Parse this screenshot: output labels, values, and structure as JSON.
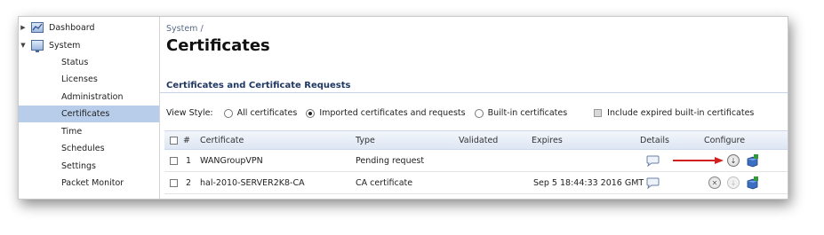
{
  "sidebar": {
    "groups": [
      {
        "label": "Dashboard",
        "icon": "dashboard-chart-icon",
        "arrow": "collapsed"
      },
      {
        "label": "System",
        "icon": "monitor-icon",
        "arrow": "expanded"
      }
    ],
    "items": [
      {
        "label": "Status"
      },
      {
        "label": "Licenses"
      },
      {
        "label": "Administration"
      },
      {
        "label": "Certificates",
        "active": true
      },
      {
        "label": "Time"
      },
      {
        "label": "Schedules"
      },
      {
        "label": "Settings"
      },
      {
        "label": "Packet Monitor"
      }
    ]
  },
  "header": {
    "breadcrumb": "System /",
    "title": "Certificates"
  },
  "section": {
    "heading": "Certificates and Certificate Requests"
  },
  "view_style": {
    "label": "View Style:",
    "options": [
      {
        "label": "All certificates",
        "checked": false
      },
      {
        "label": "Imported certificates and requests",
        "checked": true
      },
      {
        "label": "Built-in certificates",
        "checked": false
      }
    ],
    "include_expired": {
      "label": "Include expired built-in certificates",
      "checked": false,
      "disabled": true
    }
  },
  "table": {
    "columns": {
      "number": "#",
      "certificate": "Certificate",
      "type": "Type",
      "validated": "Validated",
      "expires": "Expires",
      "details": "Details",
      "configure": "Configure"
    },
    "rows": [
      {
        "number": "1",
        "certificate": "WANGroupVPN",
        "type": "Pending request",
        "validated": "",
        "expires": "",
        "actions": [
          "download-icon",
          "import-cube-icon"
        ]
      },
      {
        "number": "2",
        "certificate": "hal-2010-SERVER2K8-CA",
        "type": "CA certificate",
        "validated": "",
        "expires": "Sep 5 18:44:33 2016 GMT",
        "actions": [
          "delete-icon",
          "download-icon-disabled",
          "import-cube-icon"
        ]
      }
    ]
  },
  "colors": {
    "active_nav": "#b8cde9",
    "heading": "#1f3763",
    "annotation_arrow": "#d21f1f"
  }
}
